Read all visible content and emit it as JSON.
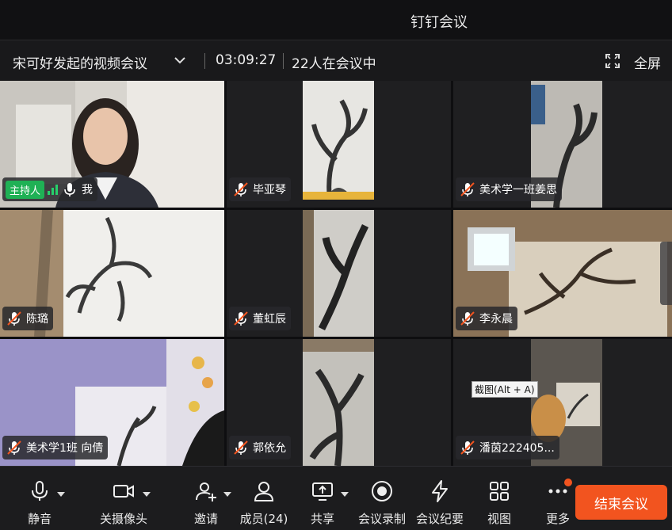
{
  "window": {
    "app_title": "钉钉会议"
  },
  "meeting": {
    "name": "宋可好发起的视频会议",
    "elapsed": "03:09:27",
    "participants_text": "22人在会议中",
    "fullscreen_label": "全屏"
  },
  "tiles": [
    {
      "name": "我",
      "host_badge": "主持人",
      "muted": false
    },
    {
      "name": "毕亚琴",
      "muted": true
    },
    {
      "name": "美术学一班姜思",
      "muted": true
    },
    {
      "name": "陈璐",
      "muted": true
    },
    {
      "name": "董虹辰",
      "muted": true
    },
    {
      "name": "李永晨",
      "muted": true
    },
    {
      "name": "美术学1班 向倩",
      "muted": true
    },
    {
      "name": "郭依允",
      "muted": true
    },
    {
      "name": "潘茵222405...",
      "muted": true
    }
  ],
  "tooltip": "截图(Alt + A)",
  "toolbar": {
    "mute": "静音",
    "camera": "关摄像头",
    "invite": "邀请",
    "members": "成员(24)",
    "share": "共享",
    "record": "会议录制",
    "minutes": "会议纪要",
    "view": "视图",
    "more": "更多",
    "end": "结束会议"
  },
  "colors": {
    "accent_end": "#f2541f",
    "host_badge": "#1fb155",
    "signal": "#27d16b"
  }
}
